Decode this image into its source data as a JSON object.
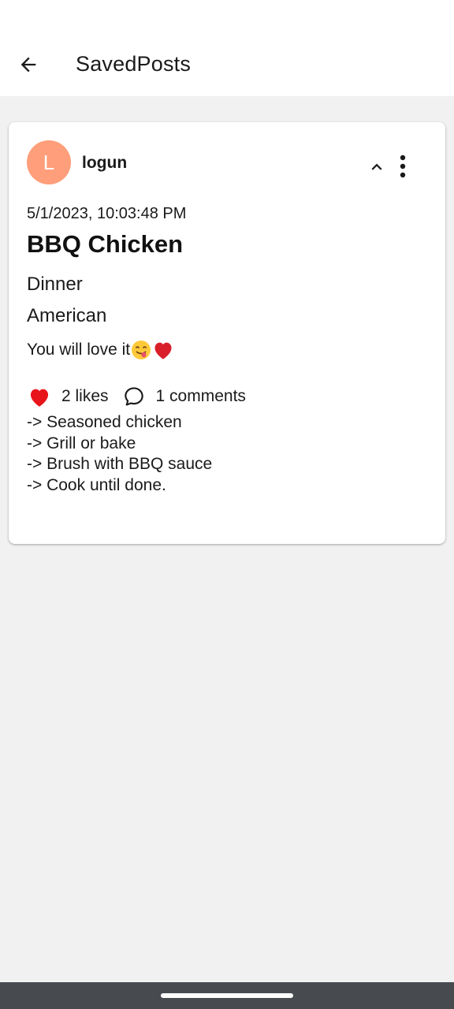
{
  "app_bar": {
    "title": "SavedPosts",
    "back_icon": "arrow-left-icon"
  },
  "post": {
    "avatar_letter": "L",
    "avatar_color": "#ff9e7a",
    "username": "logun",
    "timestamp": "5/1/2023, 10:03:48 PM",
    "title": "BBQ Chicken",
    "category": "Dinner",
    "cuisine": "American",
    "description": "You will love it",
    "likes_label": "2 likes",
    "comments_label": "1 comments",
    "like_color": "#e8141b",
    "steps": [
      "-> Seasoned chicken",
      "-> Grill or bake",
      "-> Brush with BBQ sauce",
      "-> Cook until done."
    ]
  }
}
